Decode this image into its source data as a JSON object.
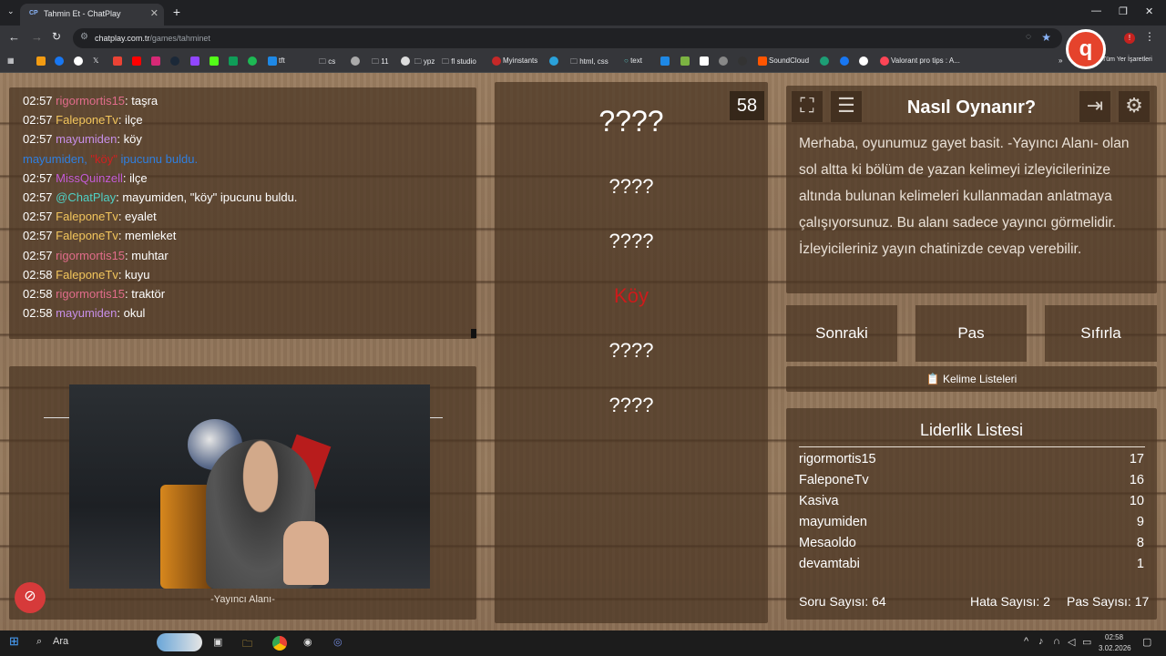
{
  "browser": {
    "tab_title": "Tahmin Et - ChatPlay",
    "tab_favicon": "CP",
    "url_host": "chatplay.com.tr",
    "url_path": "/games/tahminet",
    "bookmarks": [
      "",
      "",
      "",
      "",
      "",
      "",
      "",
      "",
      "",
      "",
      "",
      "tft",
      "cs",
      "",
      "11",
      "",
      "ypz",
      "fl studio",
      "Myinstants",
      "",
      "html, css",
      "text",
      "",
      "",
      "",
      "",
      "",
      "SoundCloud",
      "",
      "",
      "",
      "Valorant pro tips : A..."
    ],
    "all_bookmarks": "Tüm Yer İşaretleri",
    "overflow": "»"
  },
  "chat": {
    "messages": [
      {
        "time": "02:57",
        "user": "rigormortis15",
        "color": "#e06c8a",
        "text": ": taşra"
      },
      {
        "time": "02:57",
        "user": "FaleponeTv",
        "color": "#f2c55c",
        "text": ": ilçe"
      },
      {
        "time": "02:57",
        "user": "mayumiden",
        "color": "#c78fe8",
        "text": ": köy"
      },
      {
        "time": "",
        "user": "mayumiden, ",
        "color": "#2f7fe0",
        "text": "",
        "quote": "\"köy\"",
        "tail": " ipucunu buldu.",
        "tailColor": "#2f7fe0"
      },
      {
        "time": "02:57",
        "user": "MissQuinzell",
        "color": "#c35bd6",
        "text": ": ilçe"
      },
      {
        "time": "02:57",
        "user": "@ChatPlay",
        "color": "#4fd1c5",
        "text": ": mayumiden, \"köy\" ipucunu buldu."
      },
      {
        "time": "02:57",
        "user": "FaleponeTv",
        "color": "#f2c55c",
        "text": ": eyalet"
      },
      {
        "time": "02:57",
        "user": "FaleponeTv",
        "color": "#f2c55c",
        "text": ": memleket"
      },
      {
        "time": "02:57",
        "user": "rigormortis15",
        "color": "#e06c8a",
        "text": ": muhtar"
      },
      {
        "time": "02:58",
        "user": "FaleponeTv",
        "color": "#f2c55c",
        "text": ": kuyu"
      },
      {
        "time": "02:58",
        "user": "rigormortis15",
        "color": "#e06c8a",
        "text": ": traktör"
      },
      {
        "time": "02:58",
        "user": "mayumiden",
        "color": "#c78fe8",
        "text": ": okul"
      }
    ]
  },
  "streamer": {
    "label": "-Yayıncı Alanı-"
  },
  "game": {
    "timer": "58",
    "words": [
      "????",
      "????",
      "????",
      "Köy",
      "????",
      "????"
    ]
  },
  "howto": {
    "title": "Nasıl Oynanır?",
    "text": "Merhaba, oyunumuz gayet basit. -Yayıncı Alanı- olan sol altta ki bölüm de yazan kelimeyi izleyicilerinize altında bulunan kelimeleri kullanmadan anlatmaya çalışıyorsunuz. Bu alanı sadece yayıncı görmelidir. İzleyicileriniz yayın chatinizde cevap verebilir."
  },
  "controls": {
    "next": "Sonraki",
    "pass": "Pas",
    "reset": "Sıfırla",
    "lists": "Kelime Listeleri",
    "lists_icon": "📋"
  },
  "leaderboard": {
    "title": "Liderlik Listesi",
    "rows": [
      {
        "name": "rigormortis15",
        "score": "17"
      },
      {
        "name": "FaleponeTv",
        "score": "16"
      },
      {
        "name": "Kasiva",
        "score": "10"
      },
      {
        "name": "mayumiden",
        "score": "9"
      },
      {
        "name": "Mesaoldo",
        "score": "8"
      },
      {
        "name": "devamtabi",
        "score": "1"
      }
    ],
    "questions": "Soru Sayısı: 64",
    "errors": "Hata Sayısı: 2",
    "passes": "Pas Sayısı: 17"
  },
  "taskbar": {
    "search": "Ara",
    "time": "02:58",
    "date": "3.02.2026"
  }
}
